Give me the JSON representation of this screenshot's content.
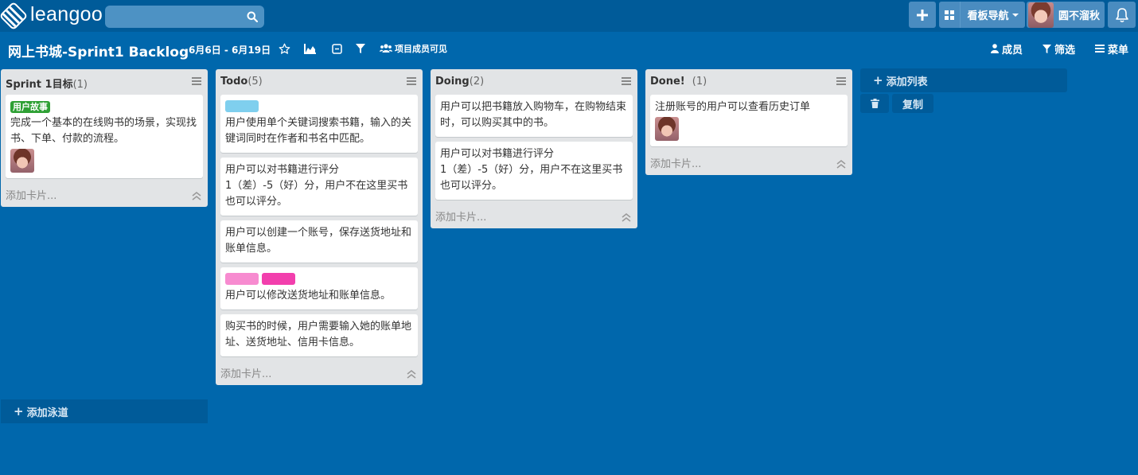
{
  "app": {
    "logo_text": "leangoo"
  },
  "topnav": {
    "search_placeholder": "",
    "add_icon": "plus-icon",
    "boards_label": "看板导航",
    "user_name": "圆不溜秋",
    "bell_icon": "bell-icon"
  },
  "board": {
    "title": "网上书城-Sprint1 Backlog",
    "dates": "6月6日 - 6月19日",
    "members_visible": "项目成员可见",
    "members_label": "成员",
    "filter_label": "筛选",
    "menu_label": "菜单"
  },
  "lists": [
    {
      "name": "Sprint 1目标",
      "count": "(1)",
      "add_card": "添加卡片...",
      "cards": [
        {
          "label": "用户故事",
          "text": "完成一个基本的在线购书的场景，实现找书、下单、付款的流程。",
          "has_avatar": true
        }
      ]
    },
    {
      "name": "Todo",
      "count": "(5)",
      "add_card": "添加卡片...",
      "cards": [
        {
          "text": "用户使用单个关键词搜索书籍，输入的关键词同时在作者和书名中匹配。",
          "chip_colors": [
            "#7fcfee"
          ]
        },
        {
          "text": "用户可以对书籍进行评分\n1（差）-5（好）分，用户不在这里买书也可以评分。"
        },
        {
          "text": "用户可以创建一个账号，保存送货地址和账单信息。"
        },
        {
          "text": "用户可以修改送货地址和账单信息。",
          "chip_colors": [
            "#f78bd0",
            "#f23fad"
          ]
        },
        {
          "text": "购买书的时候，用户需要输入她的账单地址、送货地址、信用卡信息。"
        }
      ]
    },
    {
      "name": "Doing",
      "count": "(2)",
      "add_card": "添加卡片...",
      "cards": [
        {
          "text": "用户可以把书籍放入购物车，在购物结束时，可以购买其中的书。"
        },
        {
          "text": "用户可以对书籍进行评分\n1（差）-5（好）分，用户不在这里买书也可以评分。"
        }
      ]
    },
    {
      "name": "Done!",
      "count": "(1)",
      "add_card": "添加卡片...",
      "cards": [
        {
          "text": "注册账号的用户可以查看历史订单",
          "has_avatar": true
        }
      ]
    }
  ],
  "add_list_label": "添加列表",
  "copy_label": "复制",
  "add_lane_label": "添加泳道",
  "colors": {
    "background": "#0067ac",
    "nav": "#005b99",
    "story_label": "#2ea034"
  }
}
